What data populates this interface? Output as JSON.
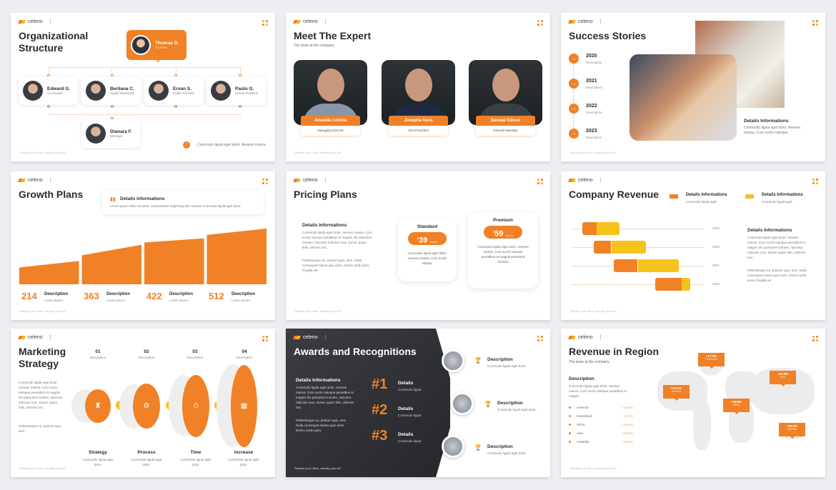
{
  "brand": {
    "name": "celeno",
    "footer": "\"Simplify your office, simplify your life\""
  },
  "colors": {
    "accent": "#f08127",
    "secondary": "#f6c31d",
    "dark": "#2b2b2b"
  },
  "slides": {
    "org": {
      "title_line1": "Organizational",
      "title_line2": "Structure",
      "founder": {
        "name": "Thomas D.",
        "role": "Founder"
      },
      "members": [
        {
          "name": "Edward G.",
          "role": "Co-founder"
        },
        {
          "name": "Berliana C.",
          "role": "Digital Marketing"
        },
        {
          "name": "Ervan S.",
          "role": "Public Relation"
        },
        {
          "name": "Paulo G.",
          "role": "Human Relation"
        },
        {
          "name": "Dianara F.",
          "role": "Manager"
        }
      ],
      "note": "Commodo ligula eget dolor. Aenean massa.",
      "note_icon": "info-icon"
    },
    "expert": {
      "title": "Meet The Expert",
      "subtitle": "The team at the company",
      "people": [
        {
          "name": "Amanda Lorista",
          "role": "Managing Director"
        },
        {
          "name": "Josepha Gora",
          "role": "Vice President"
        },
        {
          "name": "Danieal Edson",
          "role": "General Manager"
        }
      ]
    },
    "success": {
      "title": "Success Stories",
      "timeline": [
        {
          "year": "2020",
          "desc": "Description"
        },
        {
          "year": "2021",
          "desc": "Description"
        },
        {
          "year": "2022",
          "desc": "Description"
        },
        {
          "year": "2023",
          "desc": "Description"
        }
      ],
      "details_title": "Details Informations",
      "details_text": "Commodo ligula eget dolor. Aenean massa. Cum sociis natoque."
    },
    "growth": {
      "title": "Growth Plans",
      "info_title": "Details informations",
      "info_text": "Lorem ipsum dolor sit amet, consectetuer adipiscing elit. Aenean commodo ligula eget dolor.",
      "items": [
        {
          "value": "214",
          "label": "Description",
          "sub": "Lorem ipsum"
        },
        {
          "value": "363",
          "label": "Description",
          "sub": "Lorem ipsum"
        },
        {
          "value": "422",
          "label": "Description",
          "sub": "Lorem ipsum"
        },
        {
          "value": "512",
          "label": "Description",
          "sub": "Lorem ipsum"
        }
      ]
    },
    "pricing": {
      "title": "Pricing Plans",
      "details_title": "Details Informations",
      "details_p1": "Commodo ligula eget dolor. Aenean massa. Cum sociis natoque penatibus et magnis dis parturient montes, nascetur ridiculus mus. Donec quam felis, ultricies nec.",
      "details_p2": "Pellentesque eu, pretium quis, sem. Nulla consequat massa quis enim. Donec pede justo, fringilla vel.",
      "plans": [
        {
          "name": "Standard",
          "currency": "$",
          "price": "39",
          "period": "/month",
          "desc": "Commodo ligula eget dolor. Aenean massa. Cum sociis natoqu."
        },
        {
          "name": "Premium",
          "currency": "$",
          "price": "59",
          "period": "/month",
          "desc": "Commodo ligula eget dolor. Aenean massa. Cum sociis natoque penatibus et magnis parturient montes"
        }
      ]
    },
    "revenue": {
      "title": "Company Revenue",
      "legend": [
        {
          "title": "Details Informations",
          "sub": "Commodo ligula eget.",
          "color": "#f08127"
        },
        {
          "title": "Details Informations",
          "sub": "Commodo ligula eget.",
          "color": "#f6c31d"
        }
      ],
      "details_title": "Details Informations",
      "details_p1": "Commodo ligula eget dolor. Aenean massa. Cum sociis natoque penatibus et magnis dis parturient montes, nascetur ridiculus mus. Donec quam felis, ultricies nec.",
      "details_p2": "Pellentesque eu, pretium quis, sem. Nulla consequat massa quis enim. Donec pede justo, fringilla vel."
    },
    "marketing": {
      "title_line1": "Marketing",
      "title_line2": "Strategy",
      "text_p1": "Commodo ligula eget dolor. Aenean massa. Cum sociis natoque penatibus et magnis dis parturient montes, nascetur ridiculus mus. Donec quam felis, ultricies nec.",
      "text_p2": "Pellentesque eu, pretium quis, sem.",
      "steps": [
        {
          "num": "01",
          "desc": "Description",
          "label": "Strategy",
          "sub": "Commodo ligula eget dolor.",
          "icon": "chess-icon"
        },
        {
          "num": "02",
          "desc": "Description",
          "label": "Process",
          "sub": "Commodo ligula eget dolor.",
          "icon": "gears-icon"
        },
        {
          "num": "03",
          "desc": "Description",
          "label": "Time",
          "sub": "Commodo ligula eget dolor.",
          "icon": "stopwatch-icon"
        },
        {
          "num": "04",
          "desc": "Description",
          "label": "Increase",
          "sub": "Commodo ligula eget dolor.",
          "icon": "chart-icon"
        }
      ]
    },
    "awards": {
      "title": "Awards and Recognitions",
      "details_title": "Details Informations",
      "details_p1": "Commodo ligula eget dolor. Aenean massa. Cum sociis natoque penatibus et magnis dis parturient montes, nascetur ridiculus mus. Donec quam felis, ultricies nec.",
      "details_p2": "Pellentesque eu, pretium quis, sem. Nulla consequat massa quis enim. Donec pede justo.",
      "ranks": [
        {
          "rank": "#1",
          "label": "Details",
          "sub": "Commodo ligula"
        },
        {
          "rank": "#2",
          "label": "Details",
          "sub": "Commodo ligula"
        },
        {
          "rank": "#3",
          "label": "Details",
          "sub": "Commodo ligula"
        }
      ],
      "items": [
        {
          "title": "Description",
          "sub": "Commodo ligula eget dolor."
        },
        {
          "title": "Description",
          "sub": "Commodo ligula eget dolor."
        },
        {
          "title": "Description",
          "sub": "Commodo ligula eget dolor."
        }
      ]
    },
    "region": {
      "title": "Revenue in Region",
      "subtitle": "The team at the company",
      "desc_title": "Description",
      "desc_text": "Commodo ligula eget dolor. Aenean massa. Cum sociis natoque penatibus et magnis",
      "regions": [
        {
          "name": "America",
          "value": "+12.0%"
        },
        {
          "name": "Greenland",
          "value": "+17.6%"
        },
        {
          "name": "Africa",
          "value": "+15.8%"
        },
        {
          "name": "Asia",
          "value": "+25.9%"
        },
        {
          "name": "Australia",
          "value": "+30.0%"
        }
      ]
    }
  },
  "chart_data": [
    {
      "type": "area",
      "title": "Growth Plans",
      "categories": [
        "1",
        "2",
        "3",
        "4"
      ],
      "values": [
        214,
        363,
        422,
        512
      ]
    },
    {
      "type": "bar",
      "title": "Company Revenue",
      "categories": [
        "2023",
        "2022",
        "2021",
        "2020"
      ],
      "series": [
        {
          "name": "Details Informations (orange)",
          "start": [
            8,
            17,
            32,
            63
          ],
          "values": [
            11,
            13,
            18,
            20
          ]
        },
        {
          "name": "Details Informations (yellow)",
          "values": [
            17,
            26,
            31,
            7
          ]
        }
      ],
      "xlim": [
        0,
        100
      ],
      "grid": false
    }
  ]
}
